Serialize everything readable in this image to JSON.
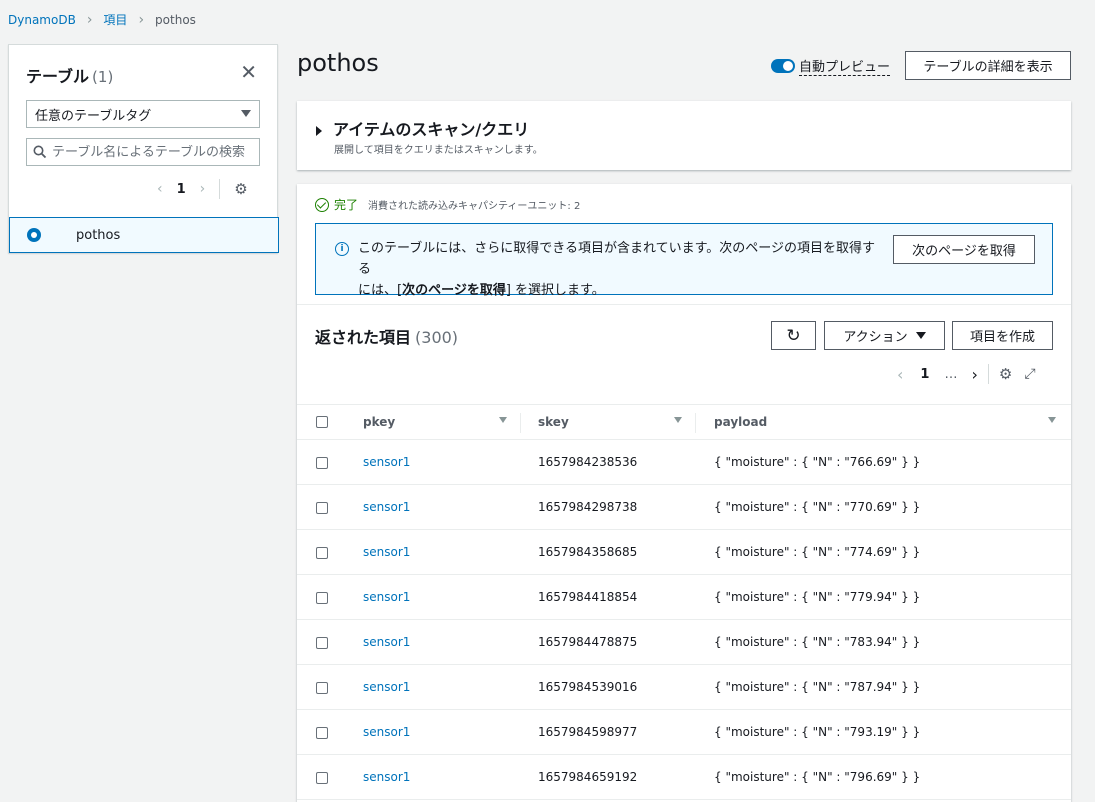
{
  "breadcrumb": {
    "items": [
      "DynamoDB",
      "項目",
      "pothos"
    ]
  },
  "sidebar": {
    "title": "テーブル",
    "count": "(1)",
    "close_symbol": "✕",
    "tag_select_value": "任意のテーブルタグ",
    "search_placeholder": "テーブル名によるテーブルの検索",
    "pager": {
      "prev": "‹",
      "page": "1",
      "next": "›",
      "gear": "⚙"
    },
    "tables": [
      {
        "name": "pothos",
        "selected": true
      }
    ]
  },
  "header": {
    "title": "pothos",
    "auto_preview_label": "自動プレビュー",
    "auto_preview_on": true,
    "details_button": "テーブルの詳細を表示"
  },
  "scan_panel": {
    "title": "アイテムのスキャン/クエリ",
    "description": "展開して項目をクエリまたはスキャンします。"
  },
  "results": {
    "status_done": "完了",
    "status_detail": "消費された読み込みキャパシティーユニット: 2",
    "info_line1": "このテーブルには、さらに取得できる項目が含まれています。次のページの項目を取得する",
    "info_line2_pre": "には、[",
    "info_line2_bold": "次のページを取得",
    "info_line2_post": "] を選択します。",
    "next_page_button": "次のページを取得",
    "title": "返された項目",
    "count": "(300)",
    "refresh_symbol": "↻",
    "actions_button": "アクション",
    "create_button": "項目を作成",
    "pager": {
      "prev": "‹",
      "page": "1",
      "ellipsis": "…",
      "next": "›",
      "gear": "⚙",
      "expand": "⤢"
    },
    "columns": [
      "pkey",
      "skey",
      "payload"
    ],
    "rows": [
      {
        "pkey": "sensor1",
        "skey": "1657984238536",
        "payload": "{ \"moisture\" : { \"N\" : \"766.69\" } }"
      },
      {
        "pkey": "sensor1",
        "skey": "1657984298738",
        "payload": "{ \"moisture\" : { \"N\" : \"770.69\" } }"
      },
      {
        "pkey": "sensor1",
        "skey": "1657984358685",
        "payload": "{ \"moisture\" : { \"N\" : \"774.69\" } }"
      },
      {
        "pkey": "sensor1",
        "skey": "1657984418854",
        "payload": "{ \"moisture\" : { \"N\" : \"779.94\" } }"
      },
      {
        "pkey": "sensor1",
        "skey": "1657984478875",
        "payload": "{ \"moisture\" : { \"N\" : \"783.94\" } }"
      },
      {
        "pkey": "sensor1",
        "skey": "1657984539016",
        "payload": "{ \"moisture\" : { \"N\" : \"787.94\" } }"
      },
      {
        "pkey": "sensor1",
        "skey": "1657984598977",
        "payload": "{ \"moisture\" : { \"N\" : \"793.19\" } }"
      },
      {
        "pkey": "sensor1",
        "skey": "1657984659192",
        "payload": "{ \"moisture\" : { \"N\" : \"796.69\" } }"
      }
    ]
  }
}
